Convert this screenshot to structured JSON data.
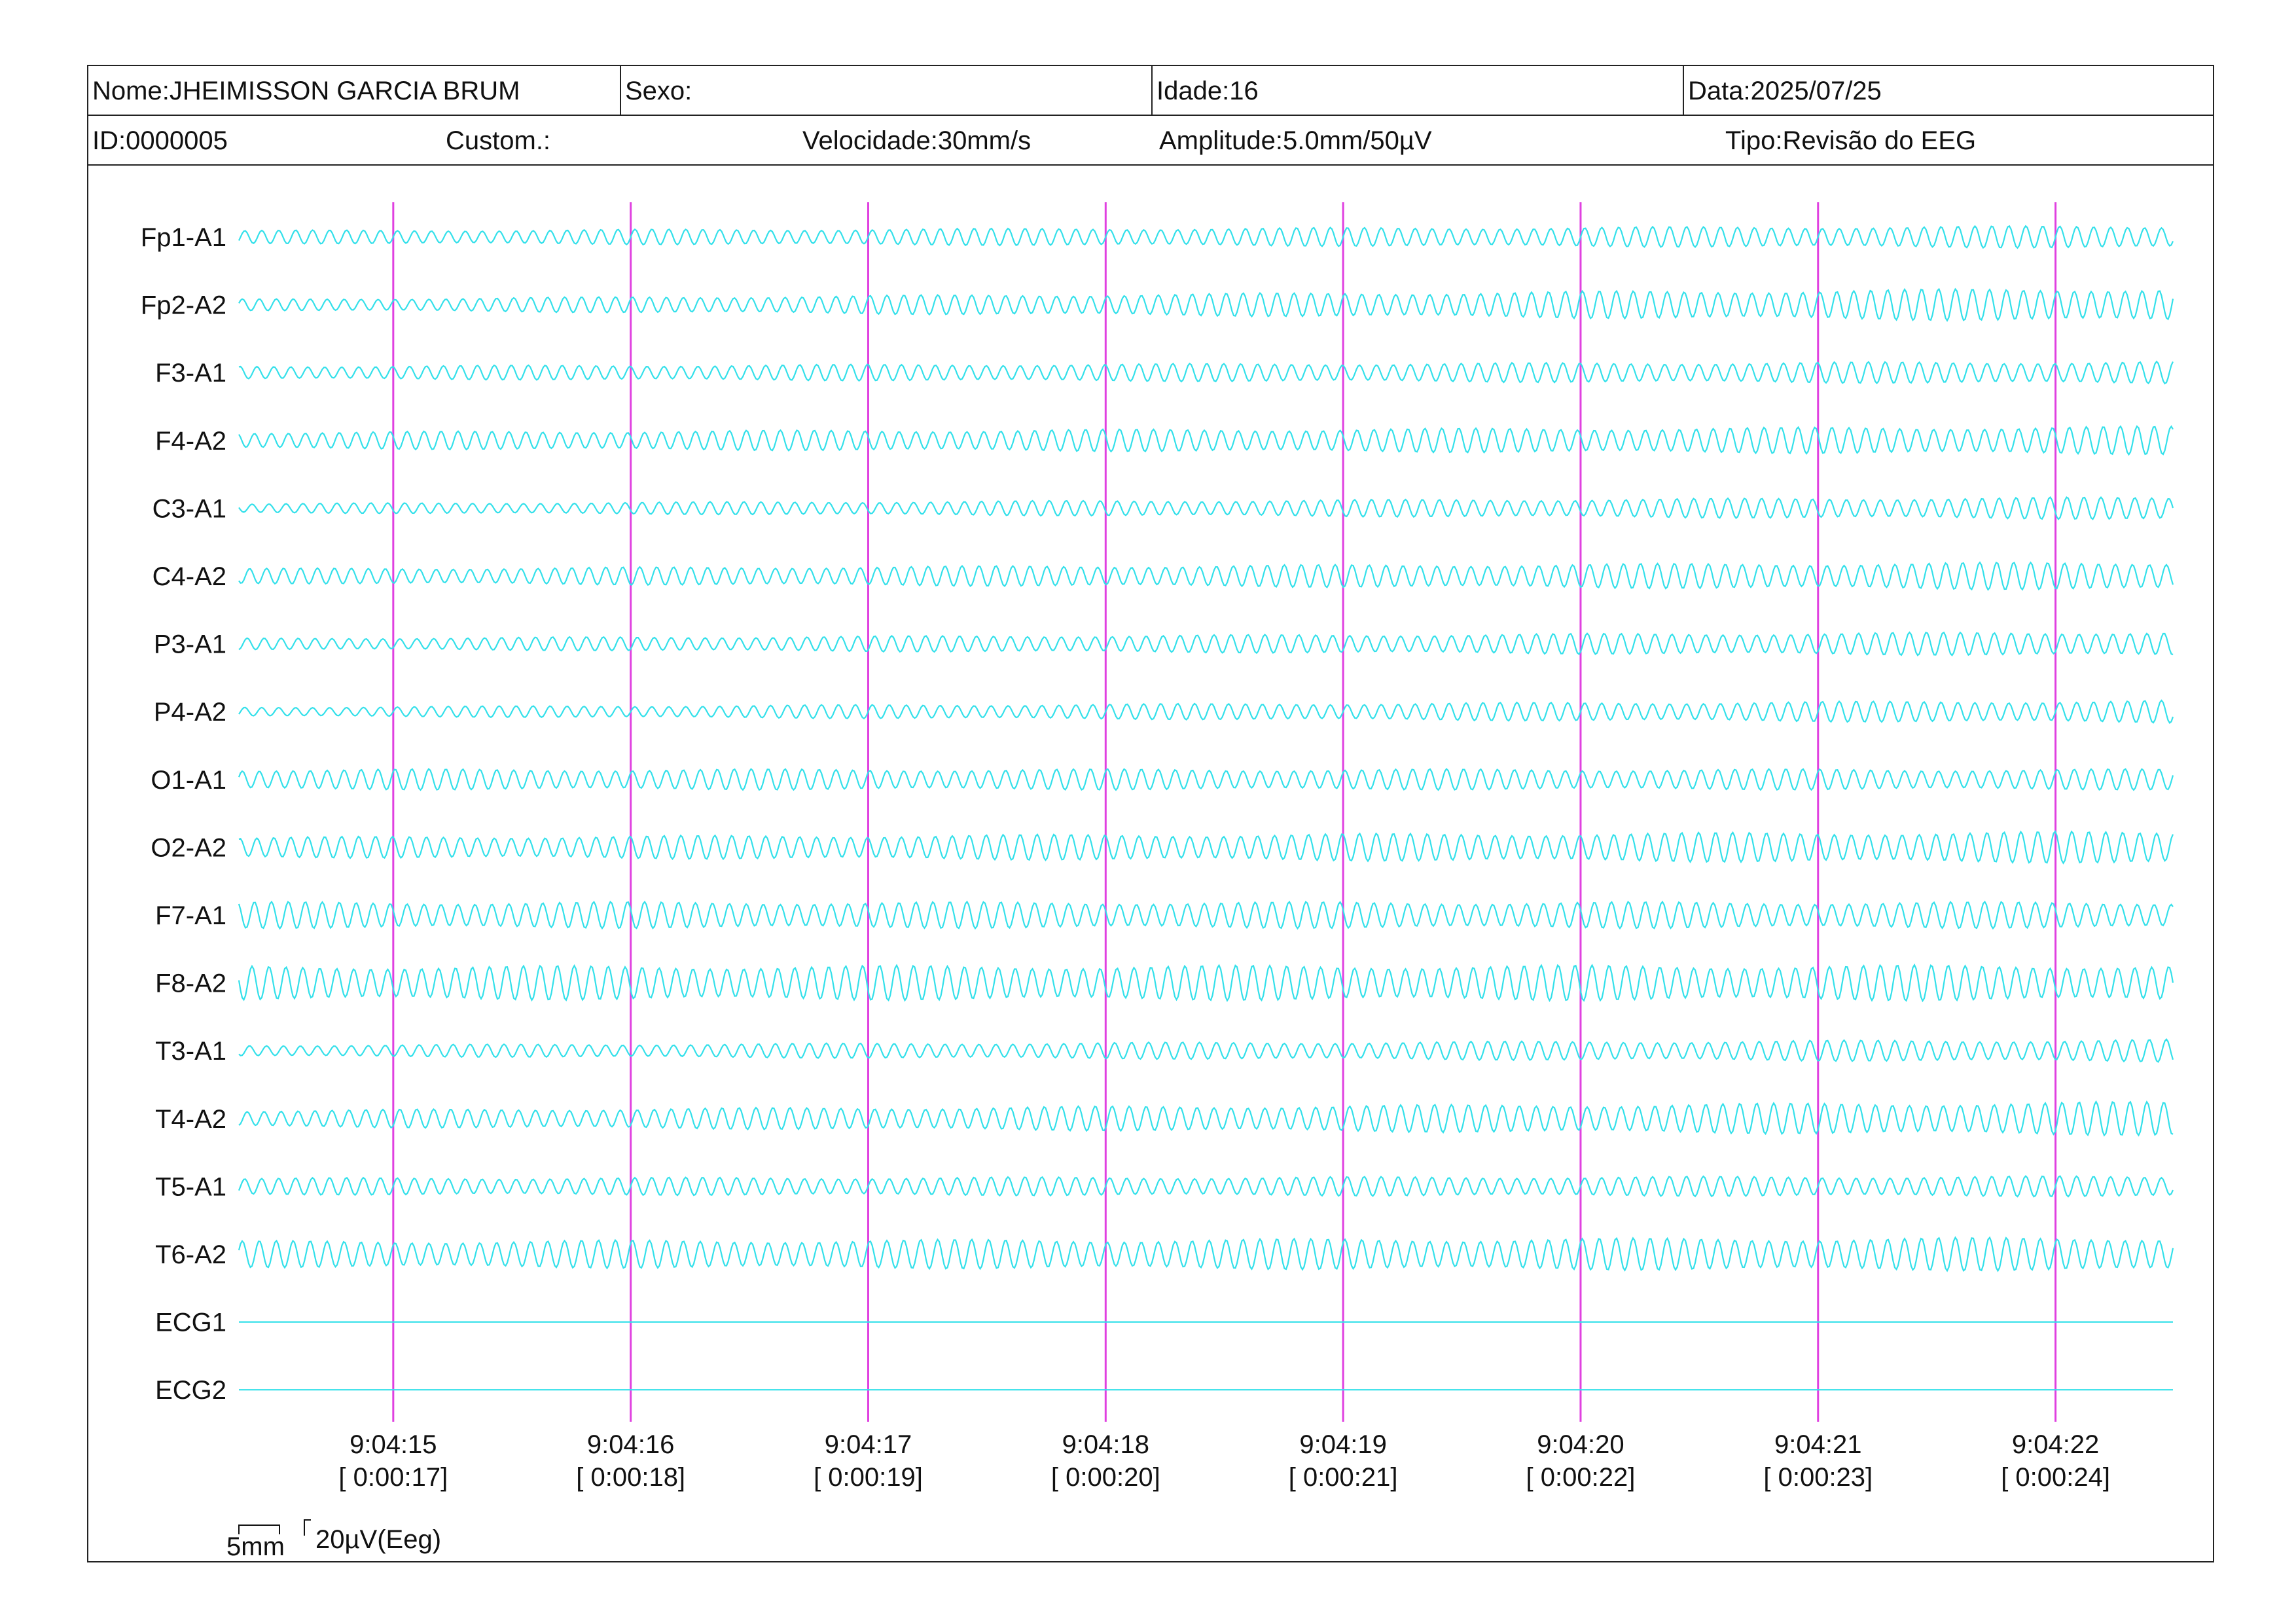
{
  "header": {
    "nome": "Nome:JHEIMISSON GARCIA BRUM",
    "sexo": "Sexo:",
    "idade": "Idade:16",
    "data": "Data:2025/07/25",
    "id": "ID:0000005",
    "custom": "Custom.:",
    "velocidade": "Velocidade:30mm/s",
    "amplitude": "Amplitude:5.0mm/50µV",
    "tipo": "Tipo:Revisão do EEG"
  },
  "colors": {
    "trace": "#33e0ea",
    "marker": "#e040e0",
    "text": "#111111",
    "border": "#222222"
  },
  "chart_data": {
    "type": "line",
    "channels": [
      "Fp1-A1",
      "Fp2-A2",
      "F3-A1",
      "F4-A2",
      "C3-A1",
      "C4-A2",
      "P3-A1",
      "P4-A2",
      "O1-A1",
      "O2-A2",
      "F7-A1",
      "F8-A2",
      "T3-A1",
      "T4-A2",
      "T5-A1",
      "T6-A2",
      "ECG1",
      "ECG2"
    ],
    "amplitude_start": [
      0.35,
      0.3,
      0.35,
      0.45,
      0.25,
      0.4,
      0.3,
      0.25,
      0.55,
      0.55,
      0.7,
      0.9,
      0.3,
      0.45,
      0.45,
      0.7,
      0,
      0
    ],
    "amplitude_end": [
      0.6,
      0.9,
      0.6,
      0.75,
      0.6,
      0.75,
      0.65,
      0.6,
      0.55,
      0.85,
      0.7,
      0.95,
      0.6,
      0.9,
      0.55,
      0.9,
      0,
      0
    ],
    "frequency_hz": 14,
    "time_start_s": 14.35,
    "time_end_s": 22.5,
    "time_ticks": [
      {
        "t": 15,
        "clock": "9:04:15",
        "elapsed": "[ 0:00:17]"
      },
      {
        "t": 16,
        "clock": "9:04:16",
        "elapsed": "[ 0:00:18]"
      },
      {
        "t": 17,
        "clock": "9:04:17",
        "elapsed": "[ 0:00:19]"
      },
      {
        "t": 18,
        "clock": "9:04:18",
        "elapsed": "[ 0:00:20]"
      },
      {
        "t": 19,
        "clock": "9:04:19",
        "elapsed": "[ 0:00:21]"
      },
      {
        "t": 20,
        "clock": "9:04:20",
        "elapsed": "[ 0:00:22]"
      },
      {
        "t": 21,
        "clock": "9:04:21",
        "elapsed": "[ 0:00:23]"
      },
      {
        "t": 22,
        "clock": "9:04:22",
        "elapsed": "[ 0:00:24]"
      }
    ],
    "scale": {
      "time_label": "5mm",
      "amp_label": "20µV(Eeg)"
    }
  }
}
